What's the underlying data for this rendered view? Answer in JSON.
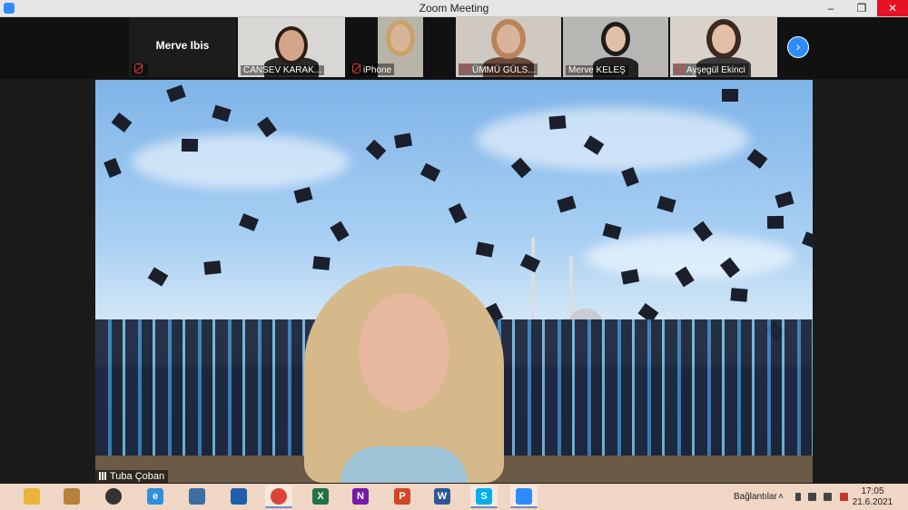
{
  "window": {
    "title": "Zoom Meeting",
    "controls": [
      "–",
      "❐",
      "✕"
    ]
  },
  "participants": [
    {
      "name": "Merve Ibis",
      "video": false,
      "muted": true
    },
    {
      "name": "CANSEV KARAK...",
      "video": true,
      "muted": false
    },
    {
      "name": "iPhone",
      "video": true,
      "muted": true
    },
    {
      "name": "ÜMMÜ GÜLS...",
      "video": true,
      "muted": true
    },
    {
      "name": "Merve KELEŞ",
      "video": true,
      "muted": false
    },
    {
      "name": "Ayşegül Ekinci",
      "video": true,
      "muted": true
    }
  ],
  "next_page_icon": "chevron-right-icon",
  "active_speaker": {
    "name": "Tuba Çoban",
    "icon": "signal-bars-icon"
  },
  "taskbar": {
    "apps": [
      {
        "name": "file-explorer-icon",
        "label": "",
        "color": "#e8b43a"
      },
      {
        "name": "app-icon-2",
        "label": "",
        "color": "#b8803a"
      },
      {
        "name": "media-player-icon",
        "label": "",
        "color": "#333333"
      },
      {
        "name": "ie-icon",
        "label": "e",
        "color": "#2f8fdc"
      },
      {
        "name": "app-icon-5",
        "label": "",
        "color": "#3a6ea5"
      },
      {
        "name": "app-icon-6",
        "label": "",
        "color": "#1d5fa8"
      },
      {
        "name": "chrome-icon",
        "label": "",
        "color": "#db4437"
      },
      {
        "name": "excel-icon",
        "label": "X",
        "color": "#217346"
      },
      {
        "name": "onenote-icon",
        "label": "N",
        "color": "#7719aa"
      },
      {
        "name": "powerpoint-icon",
        "label": "P",
        "color": "#d24726"
      },
      {
        "name": "word-icon",
        "label": "W",
        "color": "#2b579a"
      },
      {
        "name": "skype-icon",
        "label": "S",
        "color": "#00aff0"
      },
      {
        "name": "zoom-icon",
        "label": "",
        "color": "#2d8cff"
      }
    ],
    "tray": {
      "network_label": "Bağlantılar",
      "time": "17:05",
      "date": "21.6.2021"
    }
  },
  "colors": {
    "accent": "#2d8cff",
    "mute": "#e03a3a",
    "close": "#e81123"
  }
}
